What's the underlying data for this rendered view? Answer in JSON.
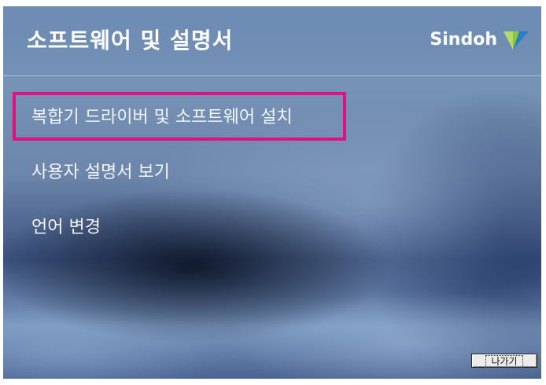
{
  "header": {
    "title": "소프트웨어 및 설명서",
    "logo_text": "Sindoh"
  },
  "menu": {
    "items": [
      {
        "label": "복합기 드라이버 및 소프트웨어 설치",
        "highlighted": true
      },
      {
        "label": "사용자 설명서 보기"
      },
      {
        "label": "언어 변경"
      }
    ]
  },
  "footer": {
    "exit_label": "나가기"
  },
  "colors": {
    "highlight": "#e0117e",
    "logo_green": "#8cc63f",
    "logo_blue": "#2a7fc7",
    "text": "#ffffff"
  }
}
